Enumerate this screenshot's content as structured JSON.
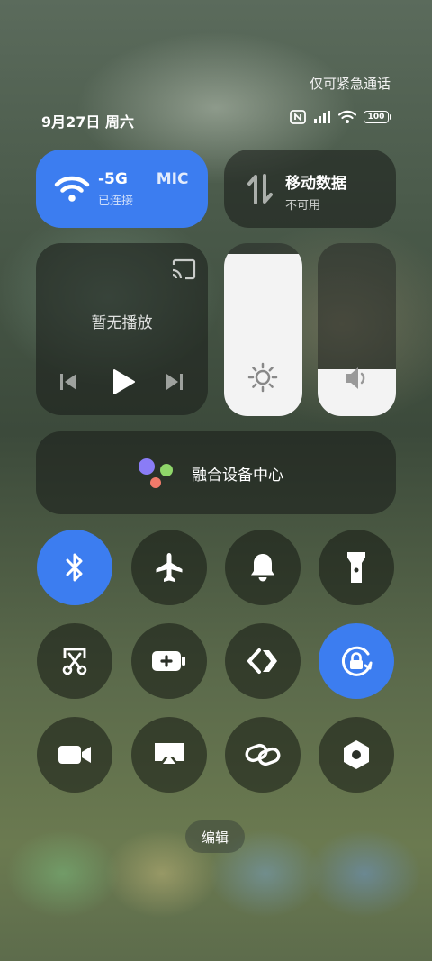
{
  "status_bar": {
    "emergency_text": "仅可紧急通话",
    "date_text": "9月27日 周六",
    "battery_level": "100"
  },
  "wifi_tile": {
    "title": "-5G",
    "title_extra": "MIC",
    "subtitle": "已连接",
    "active": true
  },
  "mobile_data_tile": {
    "title": "移动数据",
    "subtitle": "不可用"
  },
  "media_tile": {
    "label": "暂无播放"
  },
  "brightness_slider": {
    "level": 0.94
  },
  "volume_slider": {
    "level": 0.27
  },
  "fusion_center": {
    "label": "融合设备中心"
  },
  "toggles": [
    {
      "name": "bluetooth",
      "active": true
    },
    {
      "name": "airplane-mode",
      "active": false
    },
    {
      "name": "bell",
      "active": false
    },
    {
      "name": "flashlight",
      "active": false
    },
    {
      "name": "screenshot",
      "active": false
    },
    {
      "name": "battery-saver",
      "active": false
    },
    {
      "name": "direct-connect",
      "active": false
    },
    {
      "name": "rotation-lock",
      "active": true
    },
    {
      "name": "screen-record",
      "active": false
    },
    {
      "name": "screen-cast",
      "active": false
    },
    {
      "name": "link",
      "active": false
    },
    {
      "name": "settings-hex",
      "active": false
    }
  ],
  "edit_button": {
    "label": "编辑"
  },
  "colors": {
    "accent": "#3c7df0",
    "tile_dark": "#1e231d"
  }
}
